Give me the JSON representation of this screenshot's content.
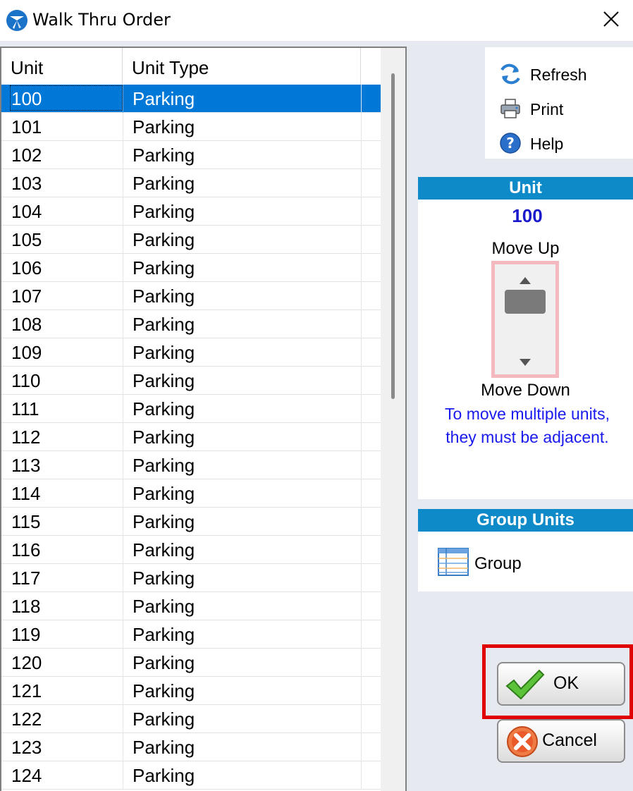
{
  "window": {
    "title": "Walk Thru Order"
  },
  "grid": {
    "columns": [
      "Unit",
      "Unit Type"
    ],
    "selected_index": 0,
    "rows": [
      {
        "unit": "100",
        "type": "Parking"
      },
      {
        "unit": "101",
        "type": "Parking"
      },
      {
        "unit": "102",
        "type": "Parking"
      },
      {
        "unit": "103",
        "type": "Parking"
      },
      {
        "unit": "104",
        "type": "Parking"
      },
      {
        "unit": "105",
        "type": "Parking"
      },
      {
        "unit": "106",
        "type": "Parking"
      },
      {
        "unit": "107",
        "type": "Parking"
      },
      {
        "unit": "108",
        "type": "Parking"
      },
      {
        "unit": "109",
        "type": "Parking"
      },
      {
        "unit": "110",
        "type": "Parking"
      },
      {
        "unit": "111",
        "type": "Parking"
      },
      {
        "unit": "112",
        "type": "Parking"
      },
      {
        "unit": "113",
        "type": "Parking"
      },
      {
        "unit": "114",
        "type": "Parking"
      },
      {
        "unit": "115",
        "type": "Parking"
      },
      {
        "unit": "116",
        "type": "Parking"
      },
      {
        "unit": "117",
        "type": "Parking"
      },
      {
        "unit": "118",
        "type": "Parking"
      },
      {
        "unit": "119",
        "type": "Parking"
      },
      {
        "unit": "120",
        "type": "Parking"
      },
      {
        "unit": "121",
        "type": "Parking"
      },
      {
        "unit": "122",
        "type": "Parking"
      },
      {
        "unit": "123",
        "type": "Parking"
      },
      {
        "unit": "124",
        "type": "Parking"
      }
    ]
  },
  "toolbox": {
    "refresh": "Refresh",
    "print": "Print",
    "help": "Help"
  },
  "unit_panel": {
    "header": "Unit",
    "value": "100",
    "move_up": "Move Up",
    "move_down": "Move Down",
    "hint_line1": "To move multiple units,",
    "hint_line2": "they must be adjacent."
  },
  "group_panel": {
    "header": "Group Units",
    "group_label": "Group"
  },
  "buttons": {
    "ok": "OK",
    "cancel": "Cancel"
  },
  "colors": {
    "accent": "#0e8ac8",
    "selection": "#0078d7",
    "highlight": "#e00000",
    "hint_text": "#1a1aee"
  }
}
